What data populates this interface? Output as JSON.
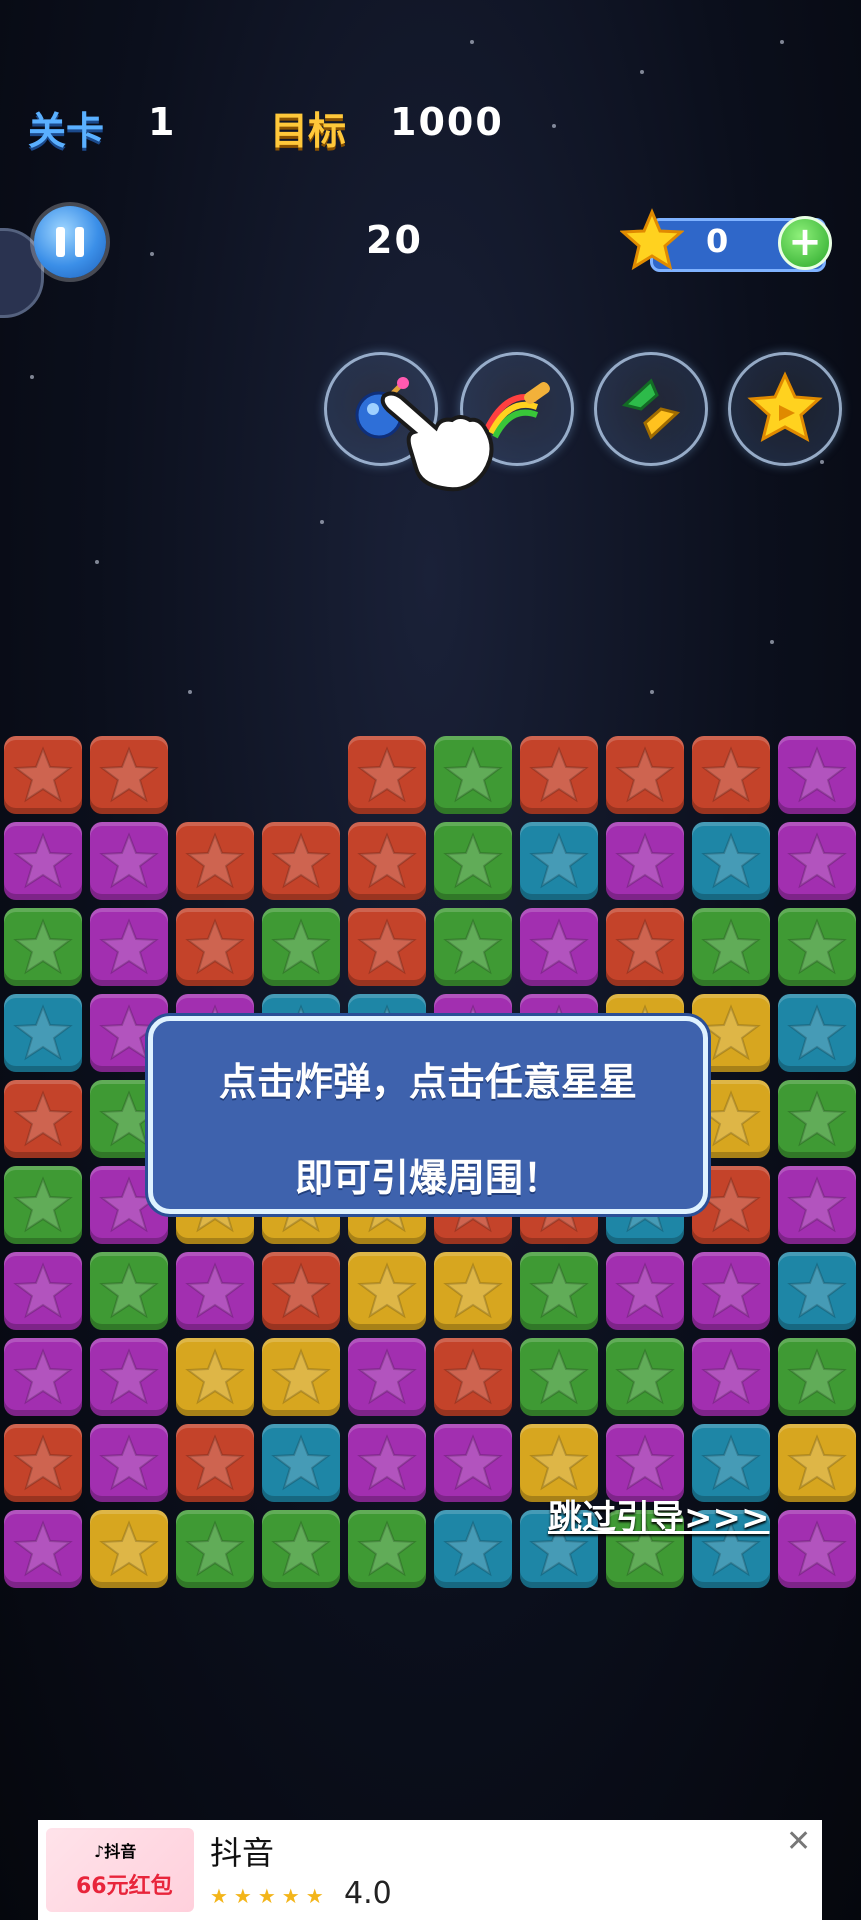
{
  "header": {
    "level_label": "关卡",
    "level_value": "1",
    "target_label": "目标",
    "target_value": "1000"
  },
  "hud": {
    "moves": "20",
    "coins": "0",
    "add_symbol": "+"
  },
  "tools": [
    {
      "name": "bomb-tool",
      "icon": "bomb-icon"
    },
    {
      "name": "rainbow-brush-tool",
      "icon": "rainbow-brush-icon"
    },
    {
      "name": "swap-tool",
      "icon": "swap-icon"
    },
    {
      "name": "video-star-tool",
      "icon": "video-star-icon"
    }
  ],
  "board": {
    "rows": [
      [
        "r",
        "r",
        "",
        "",
        "r",
        "g",
        "r",
        "r",
        "r",
        "p"
      ],
      [
        "p",
        "p",
        "r",
        "r",
        "r",
        "g",
        "b",
        "p",
        "b",
        "p"
      ],
      [
        "g",
        "p",
        "r",
        "g",
        "r",
        "g",
        "p",
        "r",
        "g",
        "g"
      ],
      [
        "b",
        "p",
        "p",
        "b",
        "b",
        "p",
        "p",
        "y",
        "y",
        "b"
      ],
      [
        "r",
        "g",
        "b",
        "y",
        "r",
        "r",
        "y",
        "y",
        "y",
        "g"
      ],
      [
        "g",
        "p",
        "y",
        "y",
        "y",
        "r",
        "r",
        "b",
        "r",
        "p"
      ],
      [
        "p",
        "g",
        "p",
        "r",
        "y",
        "y",
        "g",
        "p",
        "p",
        "b"
      ],
      [
        "p",
        "p",
        "y",
        "y",
        "p",
        "r",
        "g",
        "g",
        "p",
        "g"
      ],
      [
        "r",
        "p",
        "r",
        "b",
        "p",
        "p",
        "y",
        "p",
        "b",
        "y"
      ],
      [
        "p",
        "y",
        "g",
        "g",
        "g",
        "b",
        "b",
        "g",
        "b",
        "p"
      ]
    ],
    "colors": {
      "r": "#c4432a",
      "p": "#a22fb0",
      "g": "#3f9a34",
      "b": "#1e86a6",
      "y": "#d7a61f"
    }
  },
  "tutorial": {
    "line1": "点击炸弹，点击任意星星",
    "line2": "即可引爆周围！",
    "skip_label": "跳过引导>>>"
  },
  "ad": {
    "thumb_app": "♪抖音",
    "thumb_promo": "66元红包",
    "app_name": "抖音",
    "stars": "★★★★★",
    "rating": "4.0",
    "close_symbol": "✕"
  }
}
